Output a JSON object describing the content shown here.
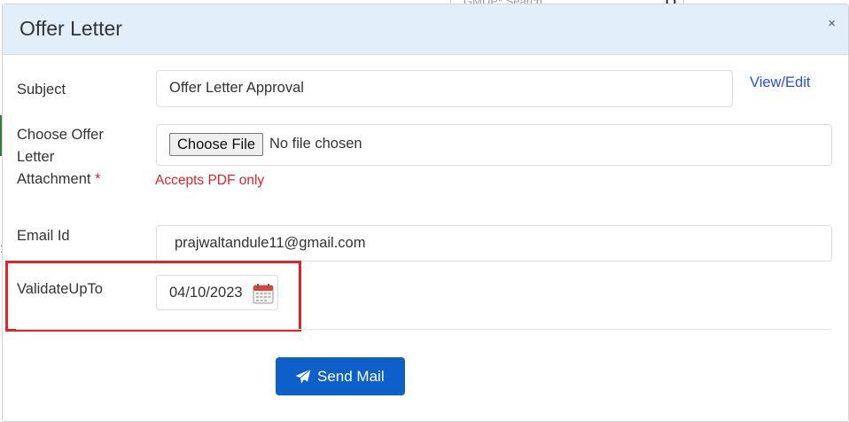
{
  "background": {
    "search_placeholder": "GMUP* Search"
  },
  "modal": {
    "title": "Offer Letter",
    "close_symbol": "×"
  },
  "form": {
    "subject": {
      "label": "Subject",
      "value": "Offer Letter Approval",
      "link_label": "View/Edit"
    },
    "attachment": {
      "label_lines": [
        "Choose Offer",
        "Letter",
        "Attachment"
      ],
      "required_mark": "*",
      "button_label": "Choose File",
      "status": "No file chosen",
      "hint": "Accepts PDF only"
    },
    "email": {
      "label": "Email Id",
      "value": "prajwaltandule11@gmail.com"
    },
    "validate": {
      "label": "ValidateUpTo",
      "value": "04/10/2023"
    }
  },
  "actions": {
    "send_label": "Send Mail"
  },
  "icons": {
    "close": "close-icon",
    "calendar": "calendar-icon",
    "send": "paper-plane-icon",
    "search": "search-icon"
  },
  "colors": {
    "header_bg": "#e3eefb",
    "primary": "#0d5fc9",
    "link": "#2a4fd9",
    "error": "#d9262b",
    "highlight": "#e0242b"
  }
}
